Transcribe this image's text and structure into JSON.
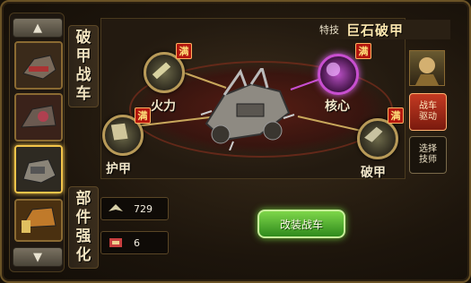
{
  "side_tab": {
    "chars": [
      "破",
      "甲",
      "战",
      "车"
    ]
  },
  "strengthen_tab": {
    "chars": [
      "部",
      "件",
      "强",
      "化"
    ]
  },
  "skill": {
    "label": "特技",
    "name": "巨石破甲"
  },
  "parts": {
    "firepower": {
      "label": "火力",
      "badge": "满",
      "icon": "cannon-icon"
    },
    "core": {
      "label": "核心",
      "badge": "满",
      "icon": "core-gem-icon"
    },
    "armor": {
      "label": "护甲",
      "badge": "满",
      "icon": "shield-armor-icon"
    },
    "break_armor": {
      "label": "破甲",
      "badge": "满",
      "icon": "ram-icon"
    }
  },
  "right_buttons": {
    "drive": [
      "战车",
      "驱动"
    ],
    "select": [
      "选择",
      "技师"
    ]
  },
  "resources": [
    {
      "icon": "wings-material-icon",
      "value": "729"
    },
    {
      "icon": "scroll-item-icon",
      "value": "6"
    }
  ],
  "action": {
    "label": "改装战车"
  },
  "colors": {
    "gold": "#c9a85c",
    "core_purple": "#c84fd0",
    "badge_red": "#b3170f",
    "green": "#4caf2a"
  }
}
